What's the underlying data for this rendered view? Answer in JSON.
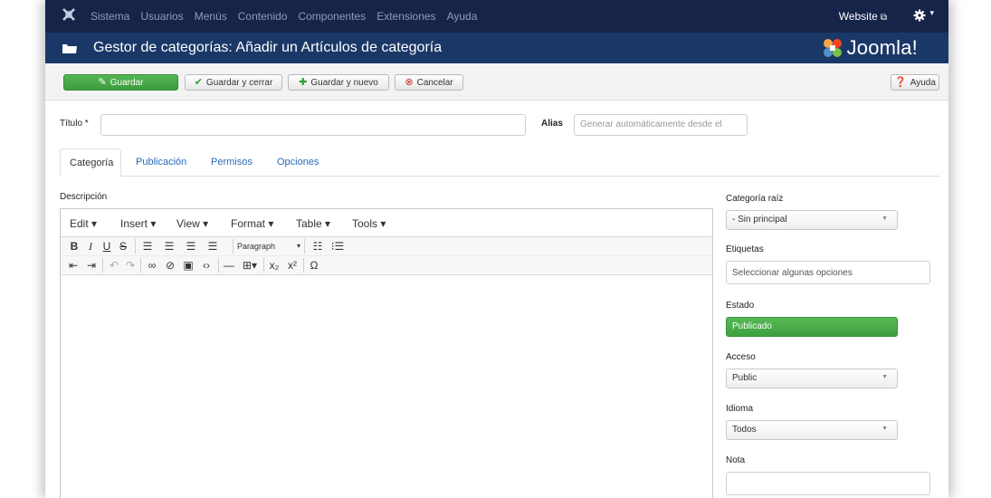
{
  "topnav": {
    "menu": [
      "Sistema",
      "Usuarios",
      "Menús",
      "Contenido",
      "Componentes",
      "Extensiones",
      "Ayuda"
    ],
    "website_label": "Website",
    "icons": [
      "joomla-x-icon",
      "external-link-icon",
      "gear-icon",
      "caret-down-icon"
    ]
  },
  "header": {
    "title": "Gestor de categorías: Añadir un Artículos de categoría",
    "brand": "Joomla!"
  },
  "toolbar": {
    "save": "Guardar",
    "save_close": "Guardar y cerrar",
    "save_new": "Guardar y nuevo",
    "cancel": "Cancelar",
    "help": "Ayuda"
  },
  "form": {
    "title_label": "Título *",
    "title_value": "",
    "alias_label": "Alias",
    "alias_placeholder": "Generar automáticamente desde el"
  },
  "tabs": [
    "Categoría",
    "Publicación",
    "Permisos",
    "Opciones"
  ],
  "editor": {
    "label": "Descripción",
    "menus": [
      "Edit ▾",
      "Insert ▾",
      "View ▾",
      "Format ▾",
      "Table ▾",
      "Tools ▾"
    ],
    "paragraph": "Paragraph"
  },
  "sidebar": {
    "parent_label": "Categoría raíz",
    "parent_value": "- Sin principal",
    "tags_label": "Etiquetas",
    "tags_placeholder": "Seleccionar algunas opciones",
    "state_label": "Estado",
    "state_value": "Publicado",
    "access_label": "Acceso",
    "access_value": "Public",
    "language_label": "Idioma",
    "language_value": "Todos",
    "note_label": "Nota",
    "note_value": ""
  },
  "colors": {
    "topnav_bg": "#16244a",
    "header_bg": "#1a3867",
    "save_green": "#46a846",
    "link_blue": "#2a69b8"
  }
}
